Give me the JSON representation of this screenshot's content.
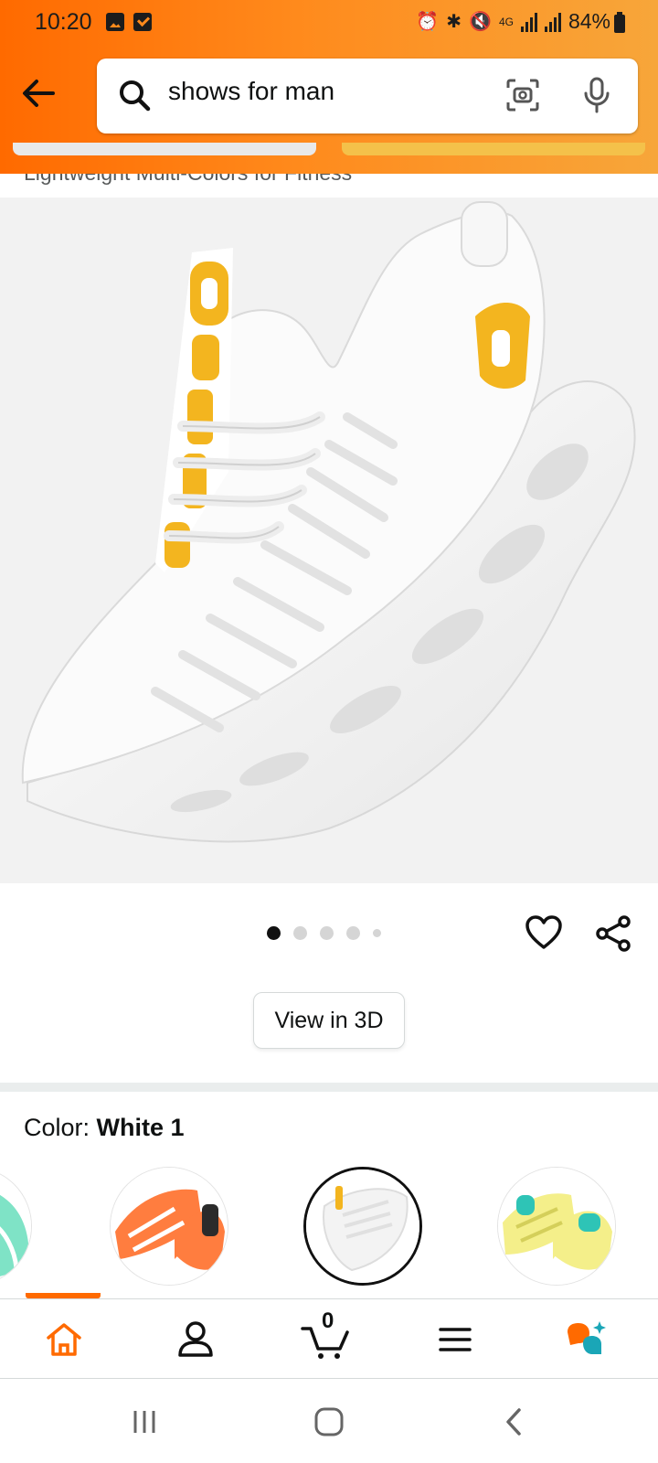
{
  "status_bar": {
    "time": "10:20",
    "battery": "84%",
    "network": "4G"
  },
  "search": {
    "query": "shows for man"
  },
  "product": {
    "title_partial": "Lightweight Multi-Colors for Fitness",
    "image_count": 5,
    "active_image": 1
  },
  "view3d": {
    "label": "View in 3D"
  },
  "color": {
    "label": "Color:",
    "selected": "White 1",
    "options": [
      "Mint",
      "Orange",
      "White 1",
      "Yellow"
    ]
  },
  "nav": {
    "items": [
      "home",
      "account",
      "cart",
      "menu",
      "rufus"
    ],
    "cart_count": "0"
  },
  "colors": {
    "accent": "#ff6a00",
    "header_gradient_end": "#f7a63a",
    "selected_border": "#111111"
  }
}
